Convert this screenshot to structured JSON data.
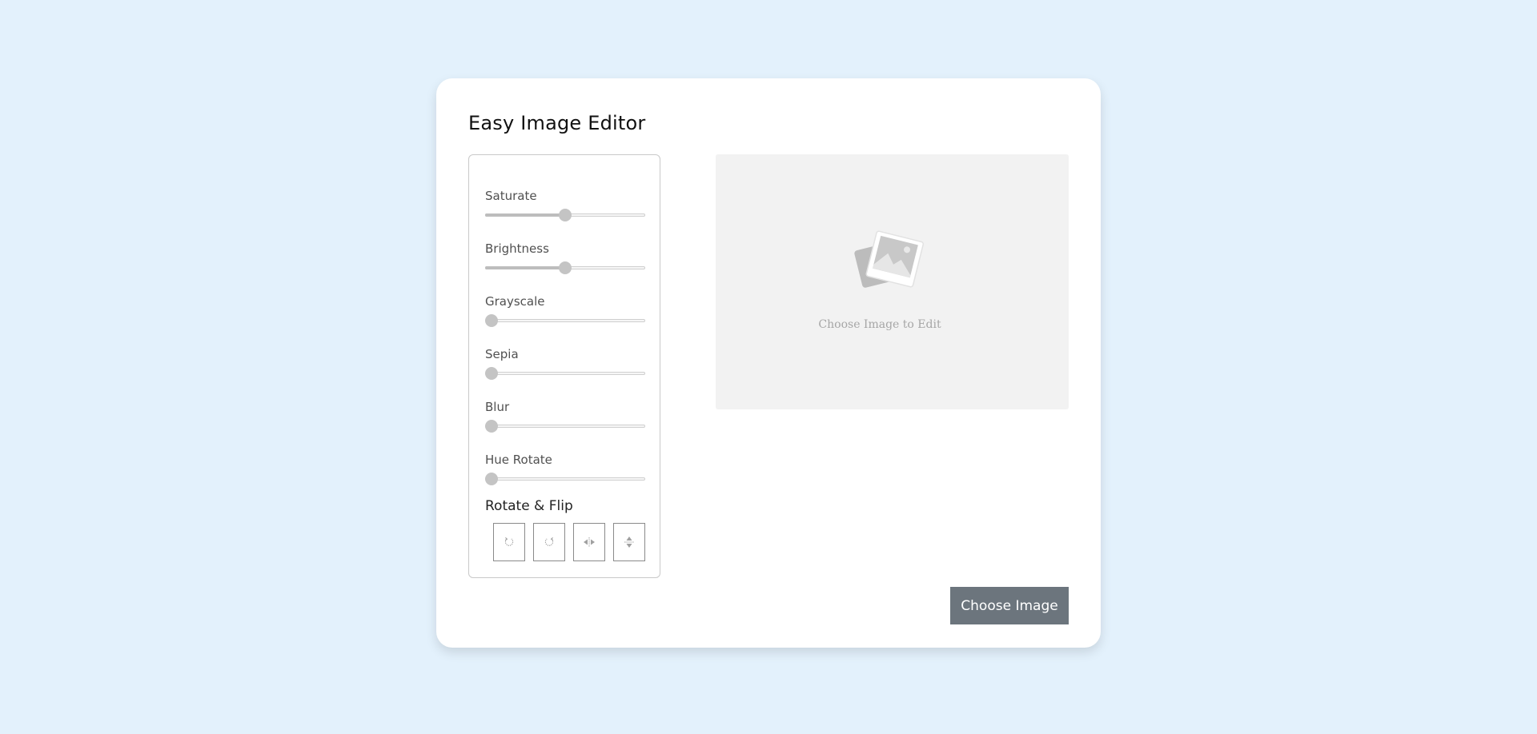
{
  "app": {
    "title": "Easy Image Editor"
  },
  "filters": [
    {
      "label": "Saturate",
      "value": 0.5
    },
    {
      "label": "Brightness",
      "value": 0.5
    },
    {
      "label": "Grayscale",
      "value": 0
    },
    {
      "label": "Sepia",
      "value": 0
    },
    {
      "label": "Blur",
      "value": 0
    },
    {
      "label": "Hue Rotate",
      "value": 0
    }
  ],
  "rotate_flip": {
    "title": "Rotate & Flip",
    "buttons": [
      {
        "icon": "rotate-left-icon"
      },
      {
        "icon": "rotate-right-icon"
      },
      {
        "icon": "flip-horizontal-icon"
      },
      {
        "icon": "flip-vertical-icon"
      }
    ]
  },
  "preview": {
    "placeholder_icon": "image-placeholder-icon",
    "placeholder_text": "Choose Image to Edit"
  },
  "actions": {
    "choose_image_label": "Choose Image"
  },
  "colors": {
    "background": "#e3f1fc",
    "card": "#ffffff",
    "preview_bg": "#f2f2f2",
    "button_bg": "#6c757d",
    "slider_thumb": "#c4c4c4"
  }
}
